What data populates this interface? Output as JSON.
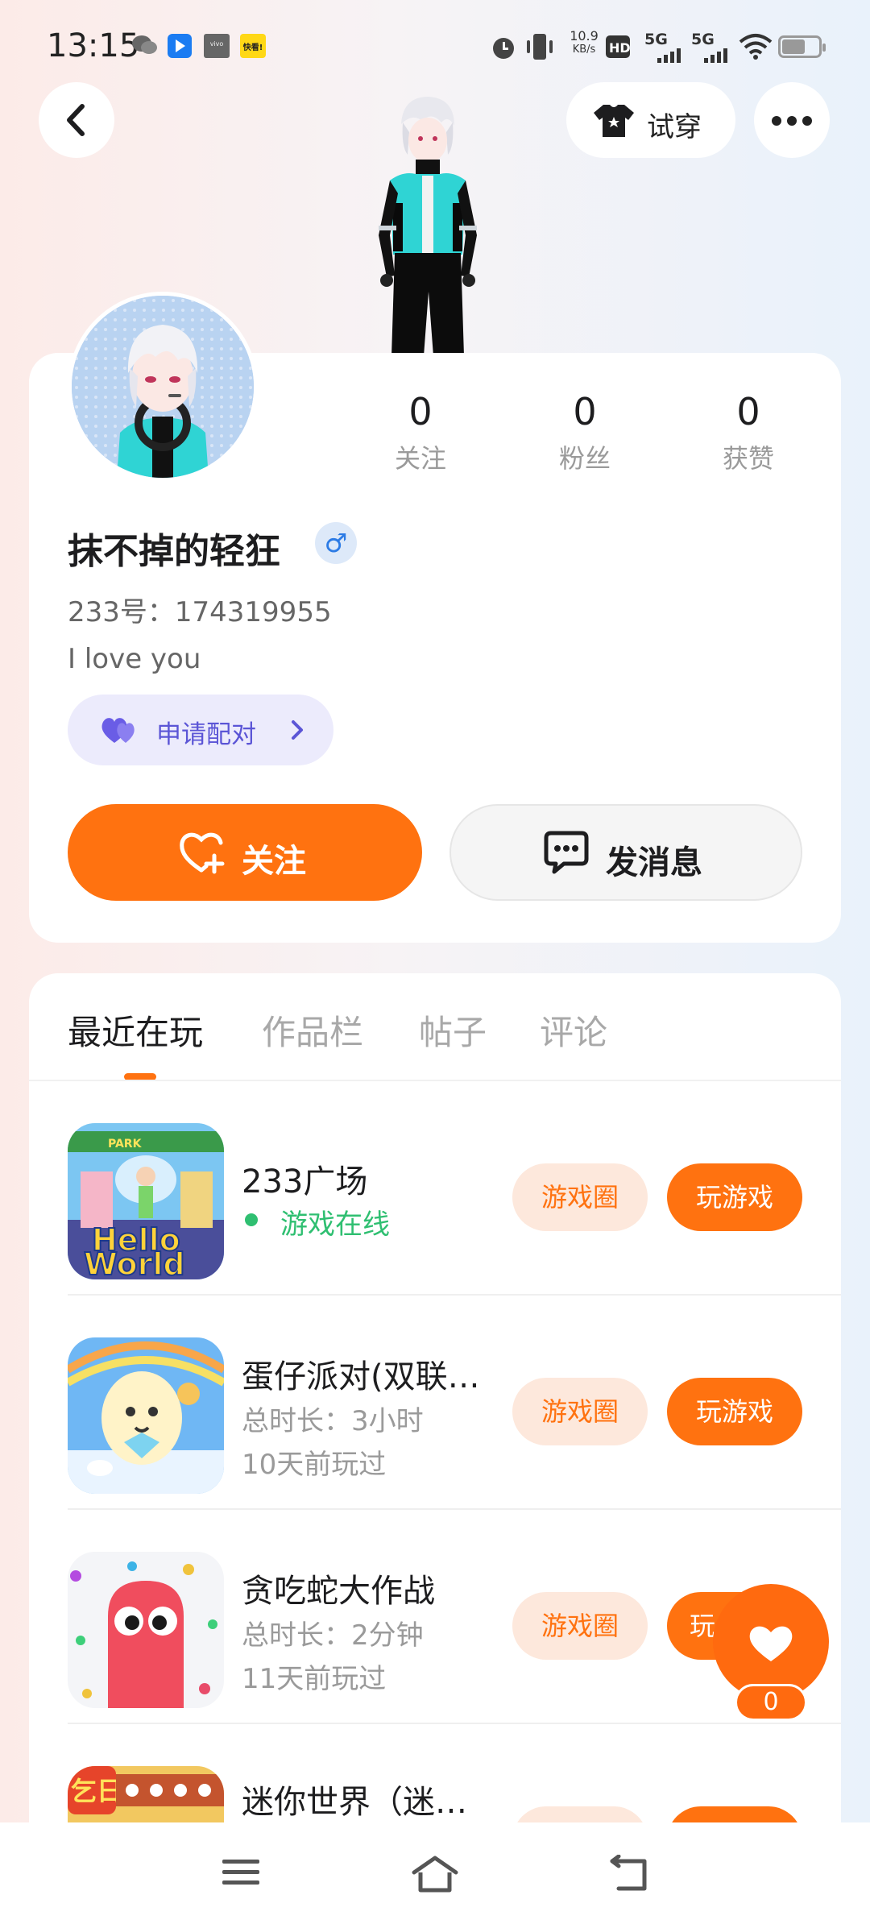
{
  "status_bar": {
    "time": "13:15",
    "net_speed_value": "10.9",
    "net_speed_unit": "KB/s",
    "signal_1": "5G",
    "signal_2": "5G",
    "app_vivo": "vivo",
    "app_yellow": "快看!"
  },
  "topbar": {
    "tryon_label": "试穿"
  },
  "profile": {
    "username": "抹不掉的轻狂",
    "gender_symbol": "♂",
    "uid": "233号：174319955",
    "bio": "I love you",
    "pair_label": "申请配对",
    "stats": [
      {
        "value": "0",
        "label": "关注"
      },
      {
        "value": "0",
        "label": "粉丝"
      },
      {
        "value": "0",
        "label": "获赞"
      }
    ],
    "follow_label": "关注",
    "message_label": "发消息"
  },
  "tabs": [
    "最近在玩",
    "作品栏",
    "帖子",
    "评论"
  ],
  "games": [
    {
      "title": "233广场",
      "status": "游戏在线",
      "circle_label": "游戏圈",
      "play_label": "玩游戏"
    },
    {
      "title": "蛋仔派对(双联…",
      "duration": "总时长：3小时",
      "last_played": "10天前玩过",
      "circle_label": "游戏圈",
      "play_label": "玩游戏"
    },
    {
      "title": "贪吃蛇大作战",
      "duration": "总时长：2分钟",
      "last_played": "11天前玩过",
      "circle_label": "游戏圈",
      "play_label": "玩"
    },
    {
      "title": "迷你世界（迷…"
    }
  ],
  "game_icon_text": {
    "hello": "Hello",
    "world": "World",
    "park": "PARK",
    "sign": "乞日"
  },
  "fab": {
    "like_count": "0"
  },
  "colors": {
    "accent": "#ff7210",
    "online_green": "#2fbf71",
    "pair_purple": "#5b55d6"
  }
}
